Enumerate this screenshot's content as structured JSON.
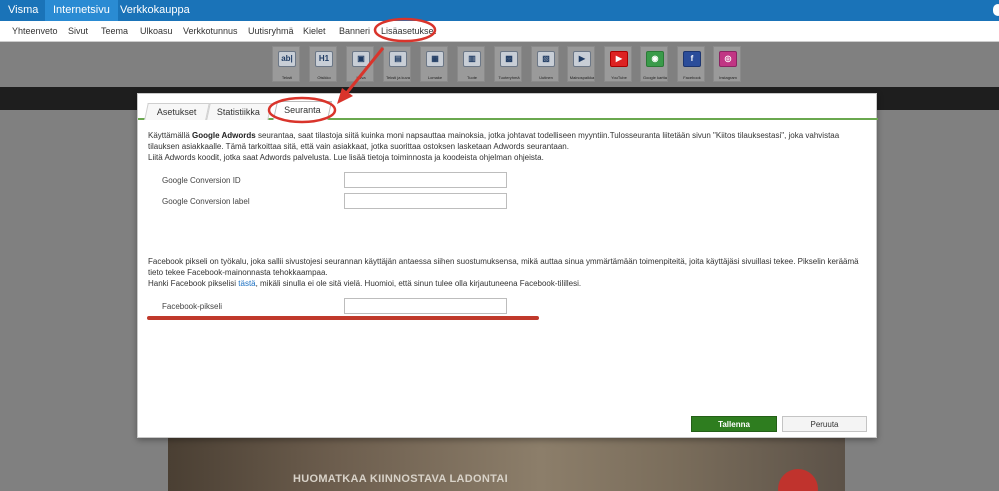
{
  "topbar": {
    "brand": "Visma",
    "tabs": [
      "Internetsivu",
      "Verkkokauppa"
    ]
  },
  "subnav": {
    "items": [
      "Yhteenveto",
      "Sivut",
      "Teema",
      "Ulkoasu",
      "Verkkotunnus",
      "Uutisryhmä",
      "Kielet",
      "Banneri",
      "Lisäasetukset"
    ]
  },
  "widgets": [
    {
      "label": "Teksti",
      "icon": "ab|"
    },
    {
      "label": "Otsikko",
      "icon": "H1"
    },
    {
      "label": "Kuva",
      "icon": "▣"
    },
    {
      "label": "Teksti ja kuva",
      "icon": "▤"
    },
    {
      "label": "Lomake",
      "icon": "▦"
    },
    {
      "label": "Tuote",
      "icon": "▥"
    },
    {
      "label": "Tuoteryhmä",
      "icon": "▩"
    },
    {
      "label": "Uutinen",
      "icon": "▧"
    },
    {
      "label": "Mainospaikka",
      "icon": "▶"
    },
    {
      "label": "YouTube",
      "icon": "▶"
    },
    {
      "label": "Google kartta",
      "icon": "◉"
    },
    {
      "label": "Facebook",
      "icon": "f"
    },
    {
      "label": "Instagram",
      "icon": "◎"
    }
  ],
  "dialog": {
    "tabs": [
      "Asetukset",
      "Statistiikka",
      "Seuranta"
    ],
    "adwords": {
      "intro_pre": "Käyttämällä ",
      "intro_bold": "Google Adwords",
      "intro_post": " seurantaa, saat tilastoja siitä kuinka moni napsauttaa mainoksia, jotka johtavat todelliseen myyntiin.Tulosseuranta liitetään sivun \"Kiitos tilauksestasi\", joka vahvistaa tilauksen asiakkaalle. Tämä tarkoittaa sitä, että vain asiakkaat, jotka suorittaa ostoksen lasketaan Adwords seurantaan.",
      "line2": "Liitä Adwords koodit, jotka saat Adwords palvelusta. Lue lisää tietoja toiminnosta ja koodeista ohjelman ohjeista.",
      "field1_label": "Google Conversion ID",
      "field1_value": "",
      "field2_label": "Google Conversion label",
      "field2_value": ""
    },
    "facebook": {
      "intro": "Facebook pikseli on työkalu, joka sallii sivustojesi seurannan käyttäjän antaessa siihen suostumuksensa, mikä auttaa sinua ymmärtämään toimenpiteitä, joita käyttäjäsi sivuillasi tekee. Pikselin keräämä tieto tekee Facebook-mainonnasta tehokkaampaa.",
      "line2_pre": "Hanki Facebook pikselisi ",
      "line2_link": "tästä",
      "line2_post": ", mikäli sinulla ei ole sitä vielä. Huomioi, että sinun tulee olla kirjautuneena Facebook-tilillesi.",
      "field_label": "Facebook-pikseli",
      "field_value": ""
    },
    "save_label": "Tallenna",
    "cancel_label": "Peruuta"
  },
  "background": {
    "banner_text": "HUOMATKAA KIINNOSTAVA LADONTAI"
  },
  "colors": {
    "topbar": "#1a73b8",
    "save": "#2e7d1f",
    "tab_rule": "#6aa84f",
    "annotation": "#d9342b"
  }
}
